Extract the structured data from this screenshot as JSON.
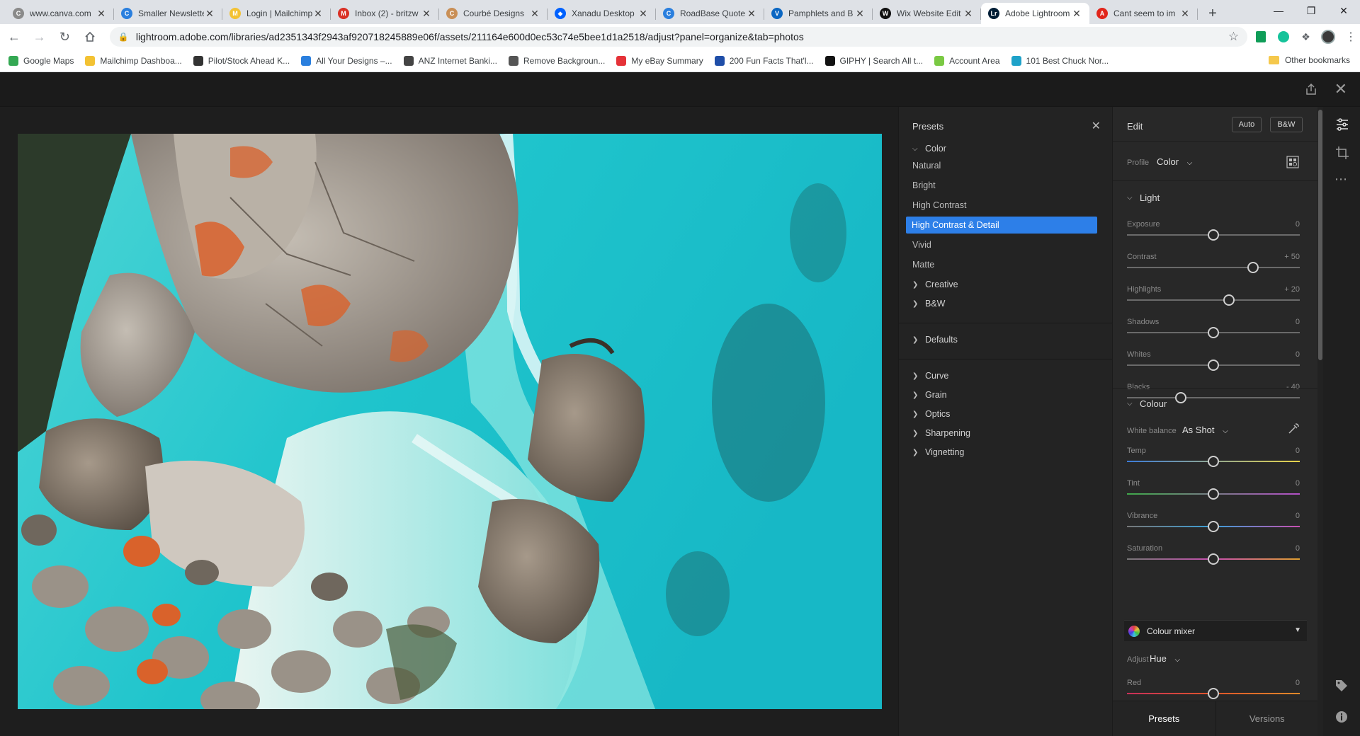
{
  "browser": {
    "tabs": [
      {
        "label": "www.canva.com",
        "icon": "canva-favicon",
        "color": "#8a8a8a",
        "glyph": "C"
      },
      {
        "label": "Smaller Newsletter",
        "icon": "canva-favicon",
        "color": "#2a7fde",
        "glyph": "C"
      },
      {
        "label": "Login | Mailchimp",
        "icon": "mailchimp-favicon",
        "color": "#f3c233",
        "glyph": "M"
      },
      {
        "label": "Inbox (2) - britzw",
        "icon": "gmail-favicon",
        "color": "#d93025",
        "glyph": "M"
      },
      {
        "label": "Courbé Designs",
        "icon": "courbe-favicon",
        "color": "#c98f56",
        "glyph": "C"
      },
      {
        "label": "Xanadu Desktop",
        "icon": "dropbox-favicon",
        "color": "#0061fe",
        "glyph": "◆"
      },
      {
        "label": "RoadBase Quote",
        "icon": "canva-favicon",
        "color": "#2a7fde",
        "glyph": "C"
      },
      {
        "label": "Pamphlets and B",
        "icon": "vistaprint-favicon",
        "color": "#0a66c2",
        "glyph": "V"
      },
      {
        "label": "Wix Website Edit",
        "icon": "wix-favicon",
        "color": "#111111",
        "glyph": "W"
      },
      {
        "label": "Adobe Lightroom",
        "icon": "lightroom-favicon",
        "color": "#001e36",
        "glyph": "Lr"
      },
      {
        "label": "Cant seem to im",
        "icon": "adobe-favicon",
        "color": "#e1251b",
        "glyph": "A"
      }
    ],
    "active_tab": 9,
    "url": "lightroom.adobe.com/libraries/ad2351343f2943af920718245889e06f/assets/211164e600d0ec53c74e5bee1d1a2518/adjust?panel=organize&tab=photos",
    "bookmarks": [
      {
        "label": "Google Maps",
        "color": "#34a853"
      },
      {
        "label": "Mailchimp Dashboa...",
        "color": "#f3c233"
      },
      {
        "label": "Pilot/Stock Ahead K...",
        "color": "#333333"
      },
      {
        "label": "All Your Designs –...",
        "color": "#2a7fde"
      },
      {
        "label": "ANZ Internet Banki...",
        "color": "#444444"
      },
      {
        "label": "Remove Backgroun...",
        "color": "#555555"
      },
      {
        "label": "My eBay Summary",
        "color": "#e53238"
      },
      {
        "label": "200 Fun Facts That'l...",
        "color": "#1f4ea8"
      },
      {
        "label": "GIPHY | Search All t...",
        "color": "#121212"
      },
      {
        "label": "Account Area",
        "color": "#7ac943"
      },
      {
        "label": "101 Best Chuck Nor...",
        "color": "#1fa2c9"
      }
    ],
    "other_bookmarks": "Other bookmarks"
  },
  "presets_panel": {
    "title": "Presets",
    "groups": {
      "color": "Color",
      "creative": "Creative",
      "bw": "B&W",
      "defaults": "Defaults",
      "curve": "Curve",
      "grain": "Grain",
      "optics": "Optics",
      "sharpening": "Sharpening",
      "vignetting": "Vignetting"
    },
    "color_items": [
      "Natural",
      "Bright",
      "High Contrast",
      "High Contrast & Detail",
      "Vivid",
      "Matte"
    ],
    "selected": "High Contrast & Detail"
  },
  "edit_panel": {
    "title": "Edit",
    "auto_label": "Auto",
    "bw_label": "B&W",
    "profile_label": "Profile",
    "profile_value": "Color",
    "light_section": "Light",
    "light_sliders": [
      {
        "label": "Exposure",
        "value": "0",
        "fraction": 0.5
      },
      {
        "label": "Contrast",
        "value": "+ 50",
        "fraction": 0.73
      },
      {
        "label": "Highlights",
        "value": "+ 20",
        "fraction": 0.59
      },
      {
        "label": "Shadows",
        "value": "0",
        "fraction": 0.5
      },
      {
        "label": "Whites",
        "value": "0",
        "fraction": 0.5
      },
      {
        "label": "Blacks",
        "value": "- 40",
        "fraction": 0.31
      }
    ],
    "colour_section": "Colour",
    "wb_label": "White balance",
    "wb_value": "As Shot",
    "colour_sliders": [
      {
        "label": "Temp",
        "value": "0",
        "fraction": 0.5,
        "gradient": "linear-gradient(90deg,#3b7bd8,#e8d44a)"
      },
      {
        "label": "Tint",
        "value": "0",
        "fraction": 0.5,
        "gradient": "linear-gradient(90deg,#3fa84a,#b34fc6)"
      },
      {
        "label": "Vibrance",
        "value": "0",
        "fraction": 0.5,
        "gradient": "linear-gradient(90deg,#777,#3a9fd8,#c84fb0)"
      },
      {
        "label": "Saturation",
        "value": "0",
        "fraction": 0.5,
        "gradient": "linear-gradient(90deg,#777,#c84fb0,#e0a030)"
      }
    ],
    "mixer_title": "Colour mixer",
    "adjust_label": "Adjust",
    "adjust_value": "Hue",
    "mixer_slider": {
      "label": "Red",
      "value": "0",
      "fraction": 0.5,
      "gradient": "linear-gradient(90deg,#c8305a,#e0562a,#e08a2a)"
    },
    "bottom_tabs": {
      "presets": "Presets",
      "versions": "Versions"
    }
  }
}
